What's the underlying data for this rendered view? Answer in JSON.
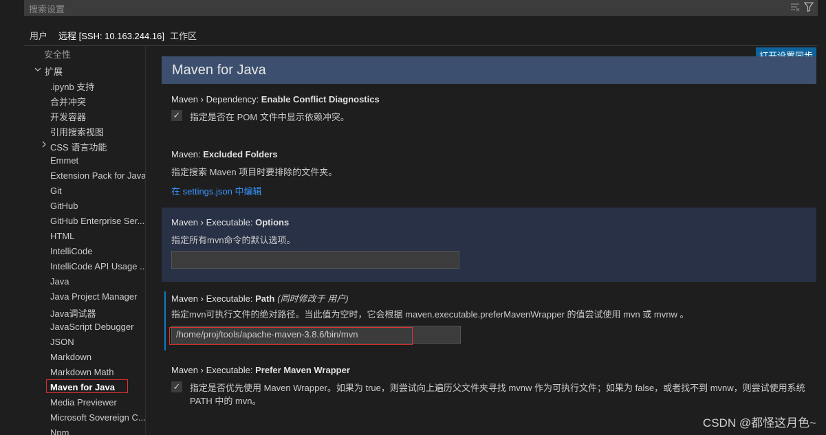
{
  "search": {
    "placeholder": "搜索设置"
  },
  "tabs": [
    {
      "label": "用户"
    },
    {
      "label": "远程 [SSH: 10.163.244.16]"
    },
    {
      "label": "工作区"
    }
  ],
  "sync_button": "打开设置同步",
  "sidebar": {
    "partial_top": "安全性",
    "group": "扩展",
    "items": [
      ".ipynb 支持",
      "合并冲突",
      "开发容器",
      "引用搜索视图",
      "CSS 语言功能",
      "Emmet",
      "Extension Pack for Java",
      "Git",
      "GitHub",
      "GitHub Enterprise Ser...",
      "HTML",
      "IntelliCode",
      "IntelliCode API Usage ...",
      "Java",
      "Java Project Manager",
      "Java调试器",
      "JavaScript Debugger",
      "JSON",
      "Markdown",
      "Markdown Math",
      "Maven for Java",
      "Media Previewer",
      "Microsoft Sovereign C...",
      "Npm"
    ]
  },
  "section_title": "Maven for Java",
  "settings": {
    "conflict": {
      "category": "Maven › Dependency: ",
      "name": "Enable Conflict Diagnostics",
      "description": "指定是否在 POM 文件中显示依赖冲突。",
      "checked": true
    },
    "excluded": {
      "category": "Maven: ",
      "name": "Excluded Folders",
      "description": "指定搜索 Maven 项目时要排除的文件夹。",
      "link": "在 settings.json 中编辑"
    },
    "options": {
      "category": "Maven › Executable: ",
      "name": "Options",
      "description": "指定所有mvn命令的默认选项。",
      "value": ""
    },
    "path": {
      "category": "Maven › Executable: ",
      "name": "Path",
      "modified_note": "(同时修改于 用户)",
      "description": "指定mvn可执行文件的绝对路径。当此值为空时，它会根据 maven.executable.preferMavenWrapper 的值尝试使用 mvn 或 mvnw 。",
      "value": "/home/proj/tools/apache-maven-3.8.6/bin/mvn"
    },
    "wrapper": {
      "category": "Maven › Executable: ",
      "name": "Prefer Maven Wrapper",
      "description_line1": "指定是否优先使用 Maven Wrapper。如果为 true，则尝试向上遍历父文件夹寻找 mvnw 作为可执行文件；如果为 false，或者找不到 mvnw，则尝试使用系统",
      "description_line2": "PATH 中的 mvn。",
      "checked": true
    }
  },
  "watermark": "CSDN @都怪这月色~",
  "colors": {
    "accent": "#0e639c",
    "header_bg": "#3c4f6e",
    "highlight": "#e03030"
  }
}
